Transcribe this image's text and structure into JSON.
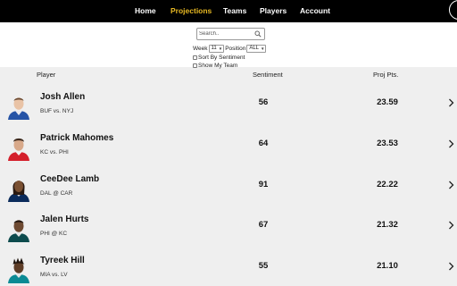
{
  "nav": {
    "home": "Home",
    "projections": "Projections",
    "teams": "Teams",
    "players": "Players",
    "account": "Account",
    "active_color": "#e8b923"
  },
  "filters": {
    "search_placeholder": "Search..",
    "week_label": "Week",
    "week_value": "11",
    "position_label": "Position",
    "position_value": "ALL",
    "sort_by_sentiment_label": "Sort By Sentiment",
    "sort_by_sentiment_checked": false,
    "show_my_team_label": "Show My Team",
    "show_my_team_checked": false
  },
  "table": {
    "headers": {
      "player": "Player",
      "sentiment": "Sentiment",
      "proj": "Proj Pts."
    },
    "rows": [
      {
        "name": "Josh Allen",
        "matchup": "BUF vs. NYJ",
        "sentiment": "56",
        "proj": "23.59",
        "icon": "player-headshot-bills"
      },
      {
        "name": "Patrick Mahomes",
        "matchup": "KC vs. PHI",
        "sentiment": "64",
        "proj": "23.53",
        "icon": "player-headshot-chiefs"
      },
      {
        "name": "CeeDee Lamb",
        "matchup": "DAL @ CAR",
        "sentiment": "91",
        "proj": "22.22",
        "icon": "player-headshot-cowboys"
      },
      {
        "name": "Jalen Hurts",
        "matchup": "PHI @ KC",
        "sentiment": "67",
        "proj": "21.32",
        "icon": "player-headshot-eagles"
      },
      {
        "name": "Tyreek Hill",
        "matchup": "MIA vs. LV",
        "sentiment": "55",
        "proj": "21.10",
        "icon": "player-headshot-dolphins"
      }
    ]
  },
  "colors": {
    "nav_bg": "#000000",
    "page_bg": "#efefef",
    "filters_bg": "#ffffff"
  }
}
